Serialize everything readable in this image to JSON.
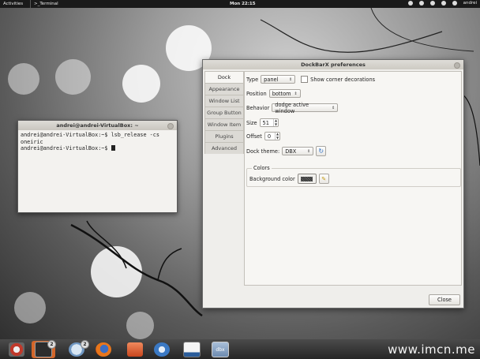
{
  "topbar": {
    "activities": "Activities",
    "app": "Terminal",
    "clock": "Mon 22:15",
    "user": "andrei"
  },
  "terminal": {
    "title": "andrei@andrei-VirtualBox: ~",
    "lines": [
      "andrei@andrei-VirtualBox:~$ lsb_release -cs",
      "oneiric",
      "andrei@andrei-VirtualBox:~$ "
    ]
  },
  "prefs": {
    "title": "DockBarX preferences",
    "tabs": [
      "Dock",
      "Appearance",
      "Window List",
      "Group Button",
      "Window Item",
      "Plugins",
      "Advanced"
    ],
    "type_label": "Type",
    "type_value": "panel",
    "corner_label": "Show corner decorations",
    "position_label": "Position",
    "position_value": "bottom",
    "behavior_label": "Behavior",
    "behavior_value": "dodge active window",
    "size_label": "Size",
    "size_value": "51",
    "offset_label": "Offset",
    "offset_value": "0",
    "theme_label": "Dock theme:",
    "theme_value": "DBX",
    "colors_label": "Colors",
    "bg_color_label": "Background color",
    "close_label": "Close"
  },
  "dock": {
    "items": [
      {
        "name": "system-settings",
        "color": "#c0392b"
      },
      {
        "name": "terminal",
        "color": "#3a3a3a",
        "badge": "2"
      },
      {
        "name": "empathy",
        "color": "#8fb4d8",
        "badge": "2"
      },
      {
        "name": "firefox",
        "color": "#e8761c"
      },
      {
        "name": "files",
        "color": "#d9542a"
      },
      {
        "name": "thunderbird",
        "color": "#3b79c4"
      },
      {
        "name": "system-monitor",
        "color": "#6b8fb8"
      },
      {
        "name": "dockbarx",
        "color": "#8fa9c8",
        "label": "dbx"
      }
    ]
  },
  "watermark": "www.imcn.me"
}
